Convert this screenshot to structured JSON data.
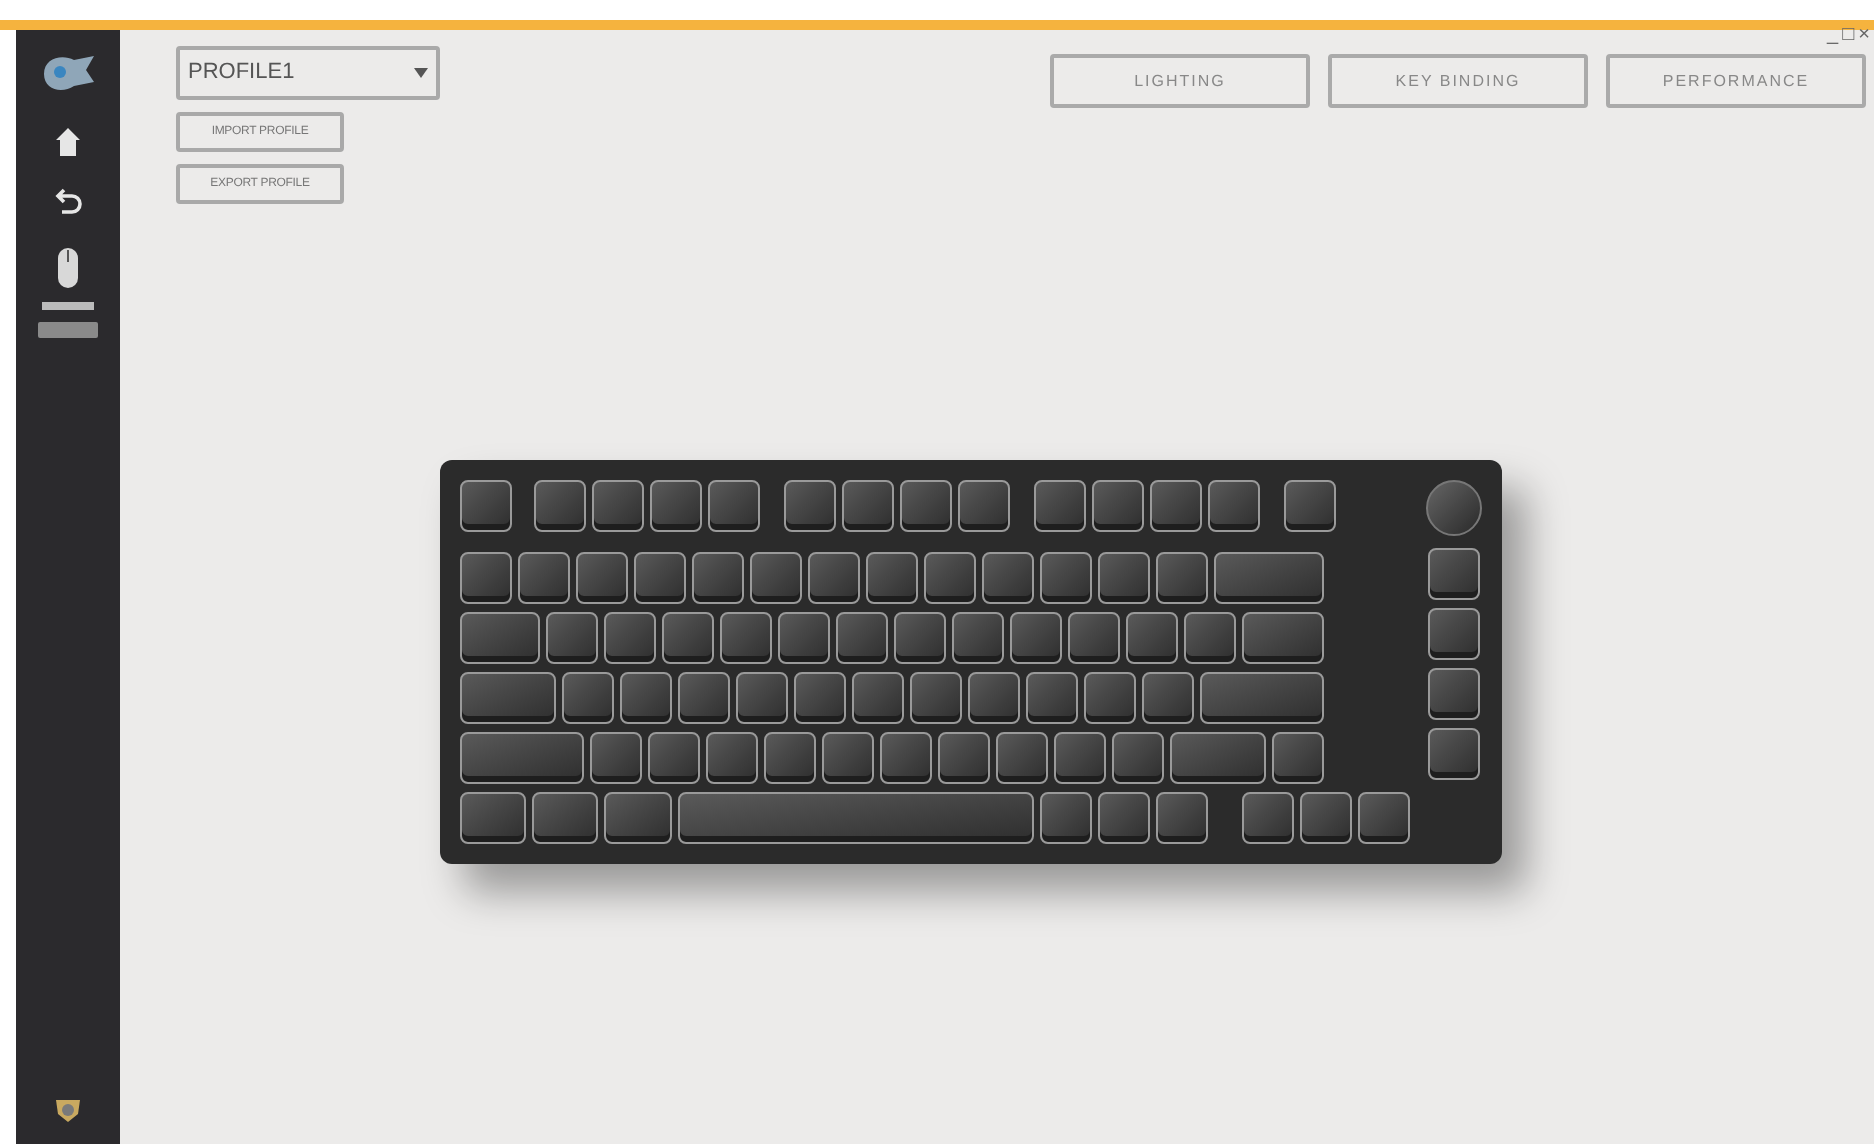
{
  "profile_select": {
    "value": "PROFILE1"
  },
  "profile_buttons": [
    "IMPORT PROFILE",
    "EXPORT PROFILE"
  ],
  "tabs": [
    {
      "label": "LIGHTING",
      "selected": false
    },
    {
      "label": "KEY BINDING",
      "selected": false
    },
    {
      "label": "PERFORMANCE",
      "selected": false
    }
  ],
  "window_controls": [
    "_",
    "□",
    "×"
  ]
}
